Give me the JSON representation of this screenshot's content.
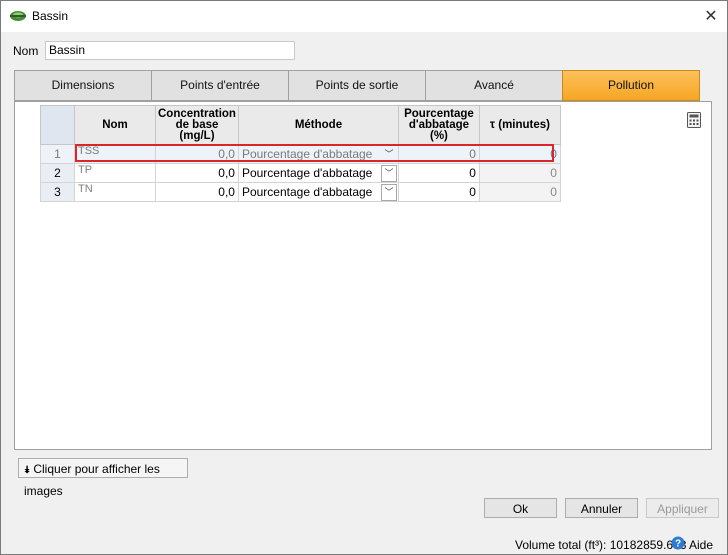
{
  "window": {
    "title": "Bassin",
    "close_label": "✕"
  },
  "name_field": {
    "label": "Nom",
    "value": "Bassin"
  },
  "tabs": [
    {
      "label": "Dimensions",
      "active": false
    },
    {
      "label": "Points d'entrée",
      "active": false
    },
    {
      "label": "Points de sortie",
      "active": false
    },
    {
      "label": "Avancé",
      "active": false
    },
    {
      "label": "Pollution",
      "active": true
    }
  ],
  "grid": {
    "headers": {
      "nom": "Nom",
      "concentration": "Concentration de base (mg/L)",
      "methode": "Méthode",
      "pourcentage": "Pourcentage d'abbatage (%)",
      "tau": "τ (minutes)"
    },
    "rows": [
      {
        "num": "1",
        "nom": "TSS",
        "concentration": "0,0",
        "methode": "Pourcentage d'abbatage",
        "pourcentage": "0",
        "tau": "0"
      },
      {
        "num": "2",
        "nom": "TP",
        "concentration": "0,0",
        "methode": "Pourcentage d'abbatage",
        "pourcentage": "0",
        "tau": "0"
      },
      {
        "num": "3",
        "nom": "TN",
        "concentration": "0,0",
        "methode": "Pourcentage d'abbatage",
        "pourcentage": "0",
        "tau": "0"
      }
    ]
  },
  "buttons": {
    "images": "Cliquer pour afficher les images",
    "ok": "Ok",
    "annuler": "Annuler",
    "appliquer": "Appliquer"
  },
  "footer": {
    "volume": "Volume total (ft³): 10182859.633",
    "aide": "Aide"
  },
  "colors": {
    "active_tab": "#f6a624",
    "selection_border": "#d9262a"
  }
}
